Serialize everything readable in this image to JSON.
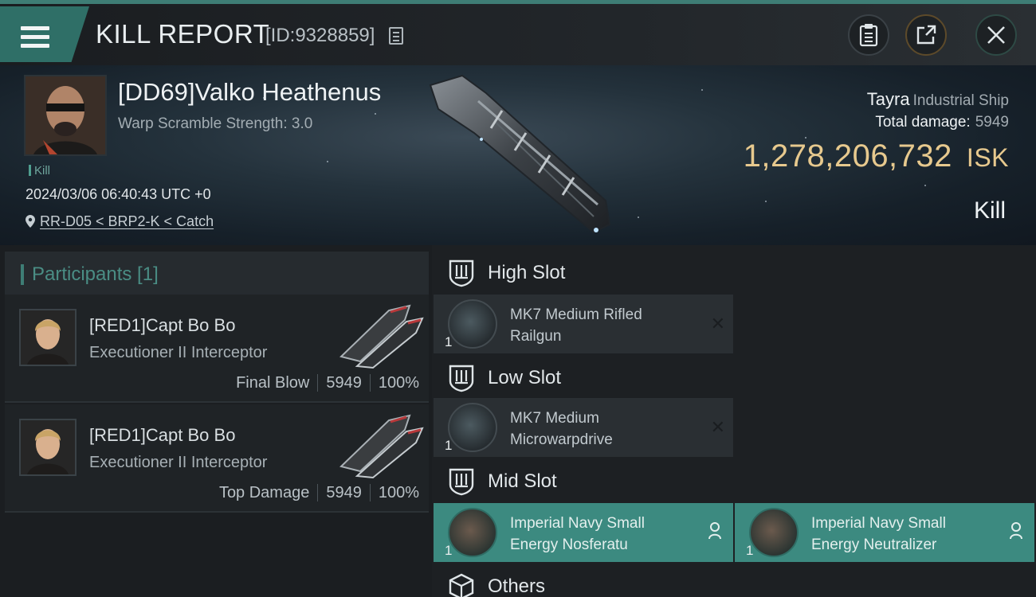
{
  "header": {
    "title": "KILL REPORT",
    "report_id": "[ID:9328859]"
  },
  "victim": {
    "pilot_name": "[DD69]Valko Heathenus",
    "warp_scramble": "Warp Scramble Strength: 3.0",
    "kill_tag": "Kill",
    "datetime": "2024/03/06 06:40:43 UTC +0",
    "location": "RR-D05 < BRP2-K < Catch",
    "ship_name": "Tayra",
    "ship_class": "Industrial Ship",
    "total_damage_label": "Total damage:",
    "total_damage_value": "5949",
    "isk_value": "1,278,206,732",
    "isk_unit": "ISK",
    "result": "Kill"
  },
  "participants": {
    "header": "Participants [1]",
    "items": [
      {
        "name": "[RED1]Capt Bo Bo",
        "ship": "Executioner II Interceptor",
        "role": "Final Blow",
        "damage": "5949",
        "percent": "100%"
      },
      {
        "name": "[RED1]Capt Bo Bo",
        "ship": "Executioner II Interceptor",
        "role": "Top Damage",
        "damage": "5949",
        "percent": "100%"
      }
    ]
  },
  "slots": {
    "high": {
      "label": "High Slot",
      "modules": [
        {
          "qty": "1",
          "name": "MK7 Medium Rifled Railgun"
        }
      ]
    },
    "low": {
      "label": "Low Slot",
      "modules": [
        {
          "qty": "1",
          "name": "MK7 Medium Microwarpdrive"
        }
      ]
    },
    "mid": {
      "label": "Mid Slot",
      "modules": [
        {
          "qty": "1",
          "name": "Imperial Navy Small Energy Nosferatu"
        },
        {
          "qty": "1",
          "name": "Imperial Navy Small Energy Neutralizer"
        }
      ]
    },
    "others": {
      "label": "Others"
    }
  },
  "colors": {
    "accent_teal": "#3c8a80",
    "isk_gold": "#e7c98e",
    "panel_dark": "#1b1e21"
  }
}
